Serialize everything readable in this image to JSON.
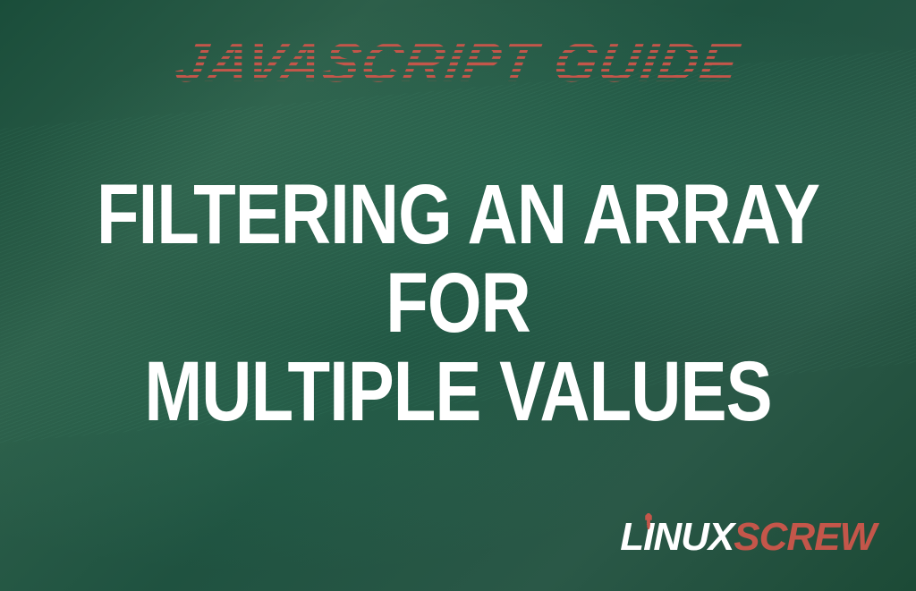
{
  "subtitle": "JAVASCRIPT GUIDE",
  "title_line1": "FILTERING AN ARRAY FOR",
  "title_line2": "MULTIPLE VALUES",
  "logo": {
    "part1": "L",
    "part2": "I",
    "part3": "NUX",
    "part4": "SCREW"
  },
  "colors": {
    "background_primary": "#1a4d3a",
    "background_secondary": "#2d5f4a",
    "accent_red": "#c4564a",
    "text_white": "#ffffff"
  }
}
